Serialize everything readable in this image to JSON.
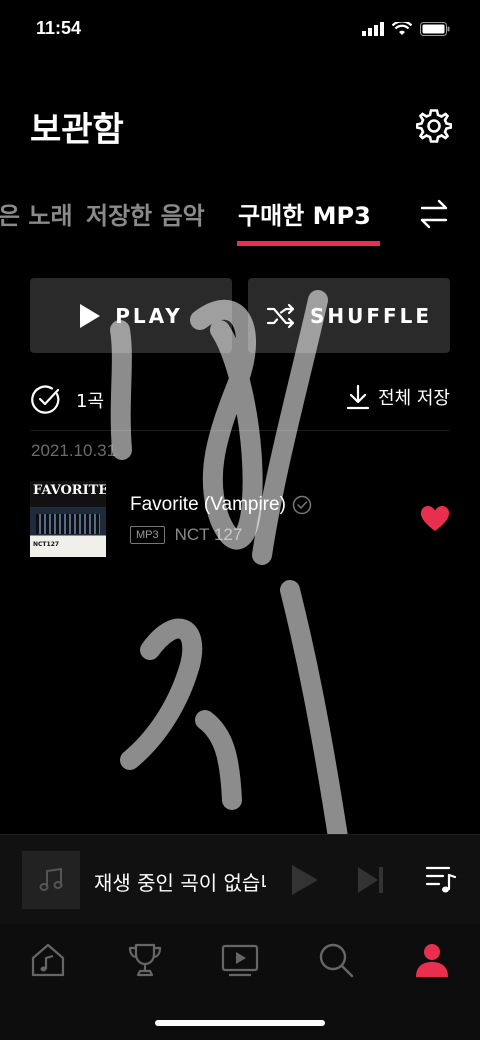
{
  "status_bar": {
    "time": "11:54"
  },
  "header": {
    "title": "보관함"
  },
  "tabs": [
    {
      "label": "은 노래",
      "active": false
    },
    {
      "label": "저장한 음악",
      "active": false
    },
    {
      "label": "구매한 MP3",
      "active": true
    }
  ],
  "actions": {
    "play_label": "PLAY",
    "shuffle_label": "SHUFFLE"
  },
  "toolbar": {
    "count": "1곡",
    "save_all": "전체 저장"
  },
  "list": {
    "date": "2021.10.31",
    "songs": [
      {
        "title": "Favorite (Vampire)",
        "badge": "MP3",
        "artist": "NCT 127",
        "album_title": "FAVORITE",
        "album_artist": "NCT127",
        "liked": true
      }
    ]
  },
  "mini_player": {
    "text": "재생 중인 곡이 없습니다"
  },
  "colors": {
    "accent": "#e8304e",
    "background": "#000000",
    "button": "#2a2a2a"
  },
  "bottom_nav": [
    "music-home-icon",
    "trophy-icon",
    "video-icon",
    "search-icon",
    "profile-icon"
  ]
}
